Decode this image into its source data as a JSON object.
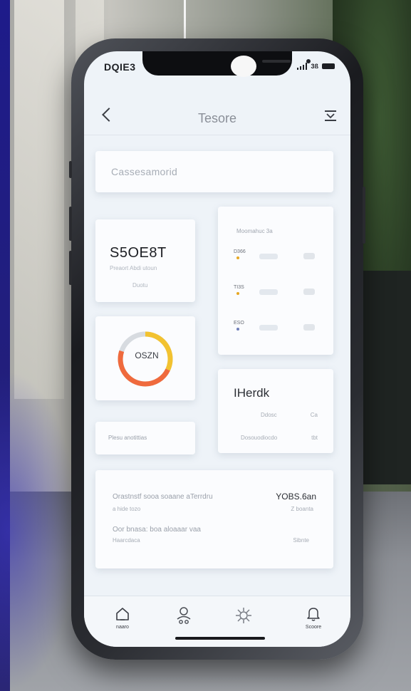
{
  "status_bar": {
    "time": "DQIE3",
    "network": "3ß"
  },
  "header": {
    "title": "Tesore"
  },
  "search": {
    "placeholder": "Cassesamorid"
  },
  "stat_card": {
    "value": "S5OE8T",
    "subtitle": "Preaort Abdi utoun",
    "footer": "Duotu"
  },
  "donut_card": {
    "label": "OSZN",
    "progress": 0.62,
    "colors": {
      "track": "#d7dbe0",
      "primary": "#ef6a3d",
      "secondary": "#f2c230"
    }
  },
  "small_card": {
    "text": "Plesu anotittias"
  },
  "list_card": {
    "header": "Moomahuc 3a",
    "rows": [
      {
        "label": "D366",
        "dot_color": "#e7a723"
      },
      {
        "label": "TI3S",
        "dot_color": "#e7a723"
      },
      {
        "label": "ESO",
        "dot_color": "#6f7eb8"
      }
    ]
  },
  "brand_card": {
    "title": "IHerdk",
    "row1_left": "Ddosc",
    "row1_right": "Ca",
    "row2_left": "Dosouodiocdo",
    "row2_right": "tbt"
  },
  "summary_card": {
    "line1": "Orastnstf sooa soaane aTerrdru",
    "line2": "a hide tozo",
    "line3": "Oor bnasa: boa aloaaar vaa",
    "line4": "Haarcdaca",
    "value": "YOBS.6an",
    "value_sub": "Z boanta",
    "action": "Sibnte"
  },
  "tabbar": {
    "items": [
      {
        "icon": "home-icon",
        "label": "naaro"
      },
      {
        "icon": "profile-icon",
        "label": ""
      },
      {
        "icon": "settings-icon",
        "label": ""
      },
      {
        "icon": "notifications-icon",
        "label": "Scoore"
      }
    ]
  }
}
